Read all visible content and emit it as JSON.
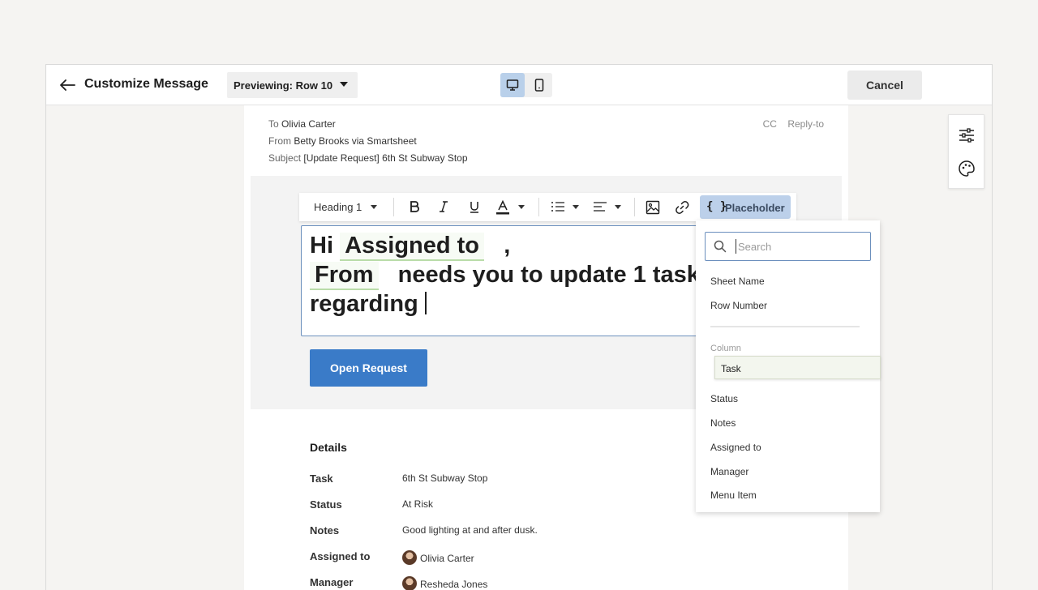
{
  "topbar": {
    "title": "Customize Message",
    "preview_label": "Previewing: Row 10",
    "cancel_label": "Cancel"
  },
  "email_headers": {
    "to_key": "To",
    "to_value": "Olivia Carter",
    "from_key": "From",
    "from_value": "Betty Brooks via Smartsheet",
    "subject_key": "Subject",
    "subject_value": "[Update Request] 6th St Subway Stop",
    "cc_label": "CC",
    "reply_to_label": "Reply-to"
  },
  "toolbar": {
    "heading_label": "Heading 1",
    "placeholder_label": "Placeholder",
    "placeholder_icon": "{ }"
  },
  "editor": {
    "greeting": "Hi",
    "chip_assigned": "Assigned to",
    "comma": ",",
    "chip_from": "From",
    "line2_text": "needs you to update 1 task",
    "line3_text": "regarding"
  },
  "open_button_label": "Open Request",
  "details": {
    "title": "Details",
    "rows": [
      {
        "key": "Task",
        "value": "6th St Subway Stop"
      },
      {
        "key": "Status",
        "value": "At Risk"
      },
      {
        "key": "Notes",
        "value": "Good lighting at and after dusk."
      },
      {
        "key": "Assigned to",
        "value": "Olivia Carter"
      },
      {
        "key": "Manager",
        "value": "Resheda Jones"
      }
    ]
  },
  "dropdown": {
    "search_placeholder": "Search",
    "items_top": [
      "Sheet Name",
      "Row Number"
    ],
    "section_label": "Column",
    "hovered_item": "Task",
    "items_columns": [
      "Status",
      "Notes",
      "Assigned to",
      "Manager",
      "Menu Item"
    ]
  },
  "colors": {
    "accent": "#3a7bc8",
    "placeholder_active": "#bcd0ea",
    "chip_underline": "#b9dca9",
    "editor_border": "#6b8fbd"
  },
  "icons": {
    "back": "arrow-left-icon",
    "desktop": "desktop-icon",
    "mobile": "mobile-icon",
    "settings": "sliders-icon",
    "theme": "palette-icon",
    "search": "search-icon"
  }
}
